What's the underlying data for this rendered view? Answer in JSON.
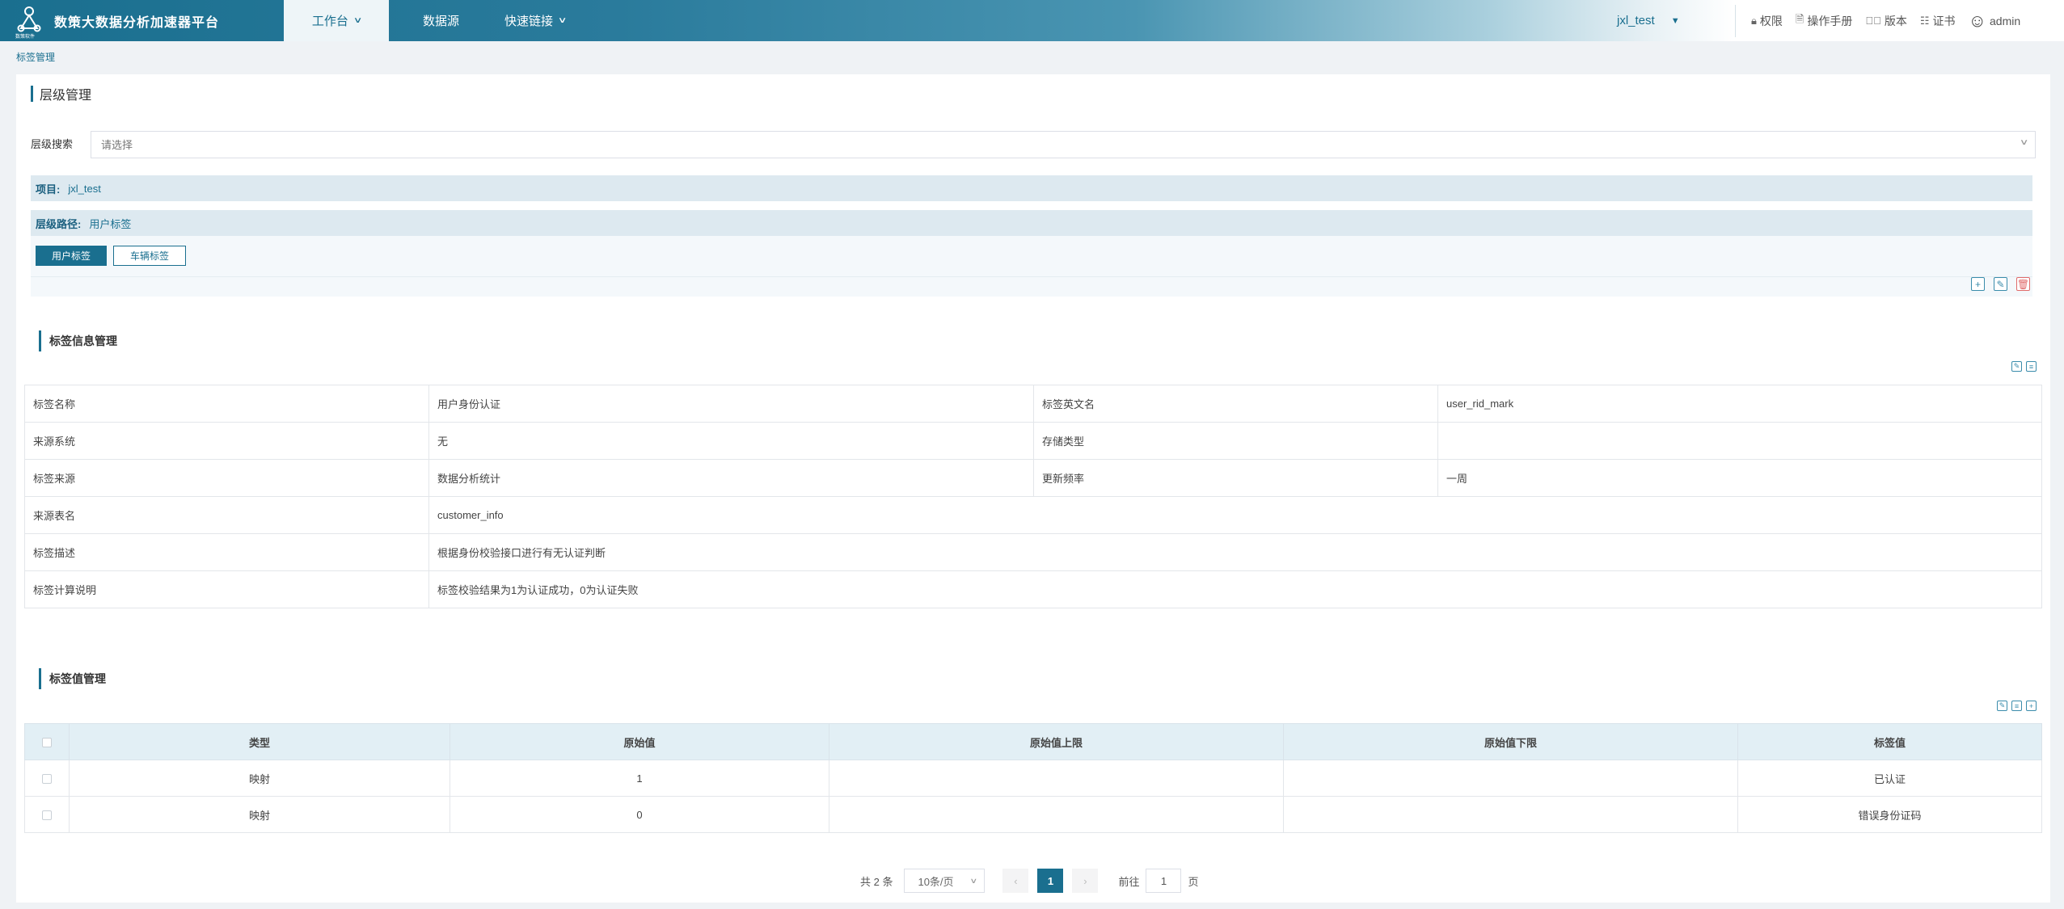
{
  "header": {
    "app_title": "数策大数据分析加速器平台",
    "logo_caption": "数策软件",
    "nav": [
      {
        "label": "工作台",
        "active": true
      },
      {
        "label": "数据源"
      },
      {
        "label": "快速链接"
      }
    ],
    "project": "jxl_test",
    "tools": [
      {
        "label": "权限",
        "icon": "lock-icon"
      },
      {
        "label": "操作手册",
        "icon": "document-icon"
      },
      {
        "label": "版本",
        "icon": "version-icon"
      },
      {
        "label": "证书",
        "icon": "certificate-icon"
      }
    ],
    "user": "admin"
  },
  "breadcrumb": "标签管理",
  "level": {
    "title": "层级管理",
    "search_label": "层级搜索",
    "search_placeholder": "请选择",
    "project_label": "项目:",
    "project_value": "jxl_test",
    "path_label": "层级路径:",
    "path_value": "用户标签",
    "tags": [
      {
        "label": "用户标签",
        "active": true
      },
      {
        "label": "车辆标签",
        "active": false
      }
    ]
  },
  "tag_info": {
    "title": "标签信息管理",
    "rows": [
      [
        "标签名称",
        "用户身份认证",
        "标签英文名",
        "user_rid_mark"
      ],
      [
        "来源系统",
        "无",
        "存储类型",
        ""
      ],
      [
        "标签来源",
        "数据分析统计",
        "更新频率",
        "一周"
      ]
    ],
    "wide_rows": [
      [
        "来源表名",
        "customer_info"
      ],
      [
        "标签描述",
        "根据身份校验接口进行有无认证判断"
      ],
      [
        "标签计算说明",
        "标签校验结果为1为认证成功，0为认证失败"
      ]
    ]
  },
  "tag_values": {
    "title": "标签值管理",
    "columns": [
      "类型",
      "原始值",
      "原始值上限",
      "原始值下限",
      "标签值"
    ],
    "rows": [
      [
        "映射",
        "1",
        "",
        "",
        "已认证"
      ],
      [
        "映射",
        "0",
        "",
        "",
        "错误身份证码"
      ]
    ]
  },
  "pagination": {
    "total": "共 2 条",
    "page_size": "10条/页",
    "current_page": "1",
    "goto_prefix": "前往",
    "goto_value": "1",
    "goto_suffix": "页"
  },
  "colors": {
    "primary": "#1a6f8f",
    "danger": "#e06b6b",
    "header_fill": "#e2eff5"
  }
}
